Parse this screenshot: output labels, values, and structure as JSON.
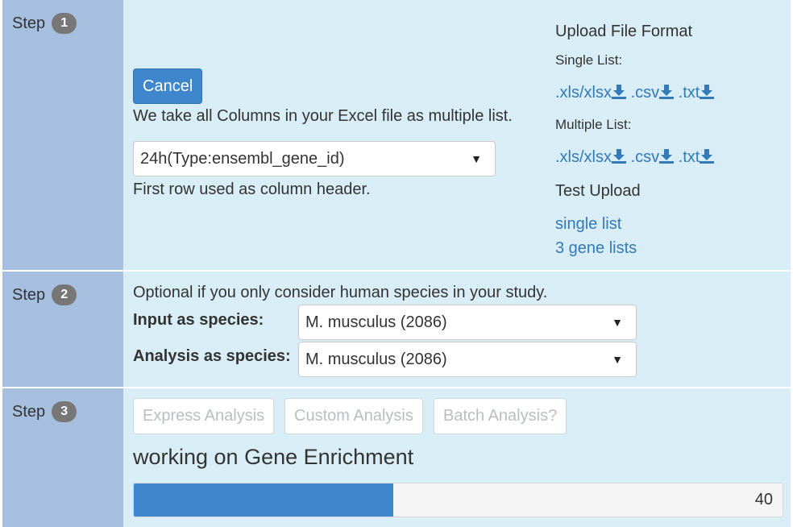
{
  "steps": [
    {
      "label": "Step",
      "number": "1"
    },
    {
      "label": "Step",
      "number": "2"
    },
    {
      "label": "Step",
      "number": "3"
    }
  ],
  "step1": {
    "cancel_label": "Cancel",
    "columns_note": "We take all Columns in your Excel file as multiple list.",
    "column_select_value": "24h(Type:ensembl_gene_id)",
    "header_note": "First row used as column header.",
    "upload_format": {
      "title": "Upload File Format",
      "single_label": "Single List:",
      "multiple_label": "Multiple List:",
      "single_links": [
        ".xls/xlsx",
        ".csv",
        ".txt"
      ],
      "multiple_links": [
        ".xls/xlsx",
        ".csv",
        ".txt"
      ]
    },
    "test_upload": {
      "title": "Test Upload",
      "links": [
        "single list",
        "3 gene lists"
      ]
    }
  },
  "step2": {
    "note": "Optional if you only consider human species in your study.",
    "input_species_label": "Input as species:",
    "input_species_value": "M. musculus (2086)",
    "analysis_species_label": "Analysis as species:",
    "analysis_species_value": "M. musculus (2086)"
  },
  "step3": {
    "buttons": [
      "Express Analysis",
      "Custom Analysis",
      "Batch Analysis?"
    ],
    "status_text": "working on Gene Enrichment",
    "progress_value": "40",
    "progress_percent": 40
  },
  "icons": {
    "caret": "▼",
    "download": "download-icon"
  },
  "colors": {
    "primary": "#3e87cc",
    "step_bg": "#a7bfdf",
    "panel_bg": "#d8edf6",
    "link": "#337ab7",
    "badge": "#777777"
  }
}
